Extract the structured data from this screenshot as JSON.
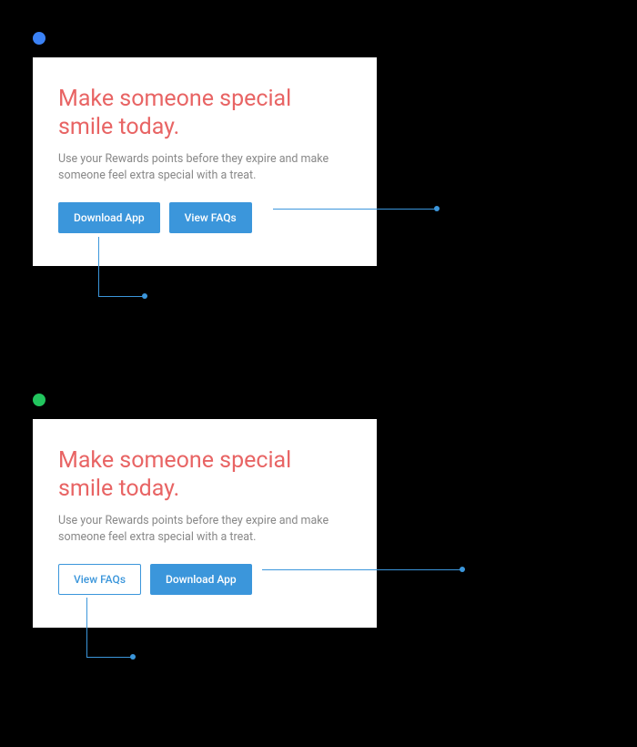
{
  "example_bad": {
    "dot_color": "#3b82f6",
    "card": {
      "title": "Make someone special smile today.",
      "subtitle": "Use your Rewards points before they expire and make someone feel extra special with a treat.",
      "buttons": [
        {
          "label": "Download App",
          "style": "primary"
        },
        {
          "label": "View FAQs",
          "style": "primary"
        }
      ]
    }
  },
  "example_good": {
    "dot_color": "#22c55e",
    "card": {
      "title": "Make someone special smile today.",
      "subtitle": "Use your Rewards points before they expire and make someone feel extra special with a treat.",
      "buttons": [
        {
          "label": "View FAQs",
          "style": "outline"
        },
        {
          "label": "Download App",
          "style": "primary"
        }
      ]
    }
  }
}
